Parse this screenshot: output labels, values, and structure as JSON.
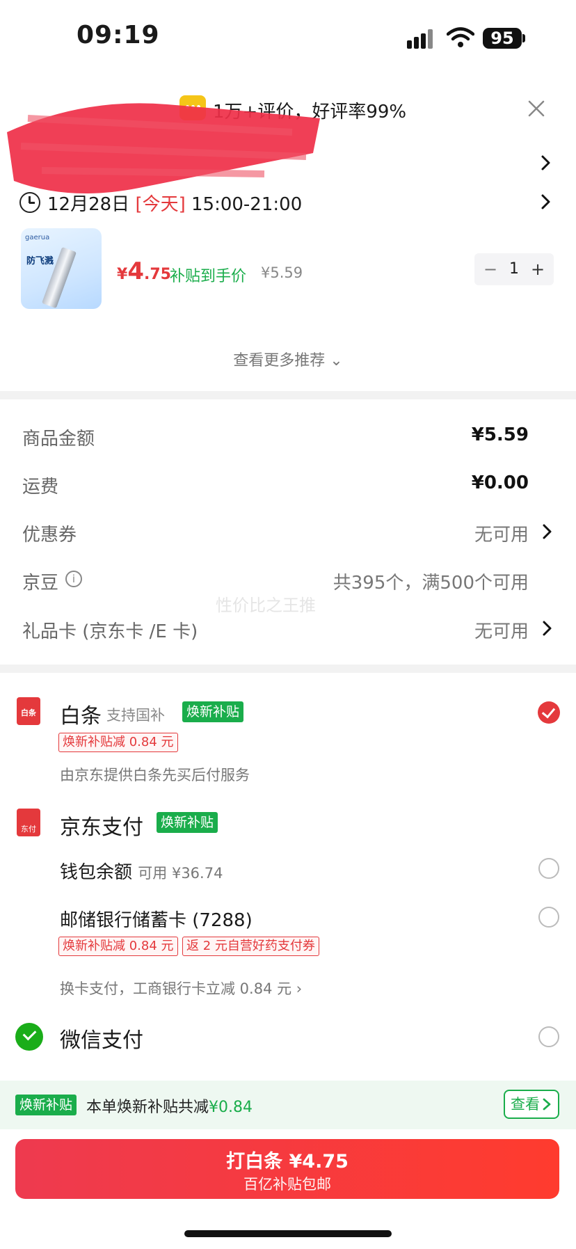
{
  "status_bar": {
    "time": "09:19",
    "battery": "95"
  },
  "review": {
    "text": "1万+评价，好评率99%"
  },
  "delivery": {
    "date": "12月28日",
    "today": "[今天]",
    "window": "15:00-21:00"
  },
  "product": {
    "brand": "gaerua",
    "image_title": "防飞溅",
    "price_currency": "¥",
    "price_int": "4",
    "price_dec": ".75",
    "subsidy_label": "补贴到手价",
    "original_price": "¥5.59",
    "quantity": "1",
    "minus": "−",
    "plus": "+"
  },
  "more_recommend": "查看更多推荐 ⌄",
  "summary": {
    "goods_label": "商品金额",
    "goods_value": "¥5.59",
    "shipping_label": "运费",
    "shipping_value": "¥0.00",
    "coupon_label": "优惠券",
    "coupon_value": "无可用",
    "jingdou_label": "京豆",
    "jingdou_value": "共395个，满500个可用",
    "giftcard_label": "礼品卡 (京东卡 /E 卡)",
    "giftcard_value": "无可用",
    "watermark": "性价比之王推"
  },
  "payment": {
    "baitiao": {
      "icon": "白条",
      "title": "白条",
      "sub": "支持国补",
      "tag": "焕新补贴",
      "discount": "焕新补贴减 0.84 元",
      "note": "由京东提供白条先买后付服务"
    },
    "jdpay": {
      "icon": "东付",
      "title": "京东支付",
      "tag": "焕新补贴",
      "wallet_label": "钱包余额",
      "wallet_hint": "可用 ¥36.74",
      "card_label": "邮储银行储蓄卡 (7288)",
      "card_discount": "焕新补贴减 0.84 元",
      "card_coupon": "返 2 元自营好药支付券",
      "switch_note": "换卡支付，工商银行卡立减 0.84 元 ›"
    },
    "wechat": {
      "title": "微信支付"
    }
  },
  "subsidy_bar": {
    "tag": "焕新补贴",
    "text": "本单焕新补贴共减",
    "amount": "¥0.84",
    "view": "查看"
  },
  "pay_button": {
    "line1": "打白条 ¥4.75",
    "line2": "百亿补贴包邮"
  },
  "colors": {
    "accent_red": "#e4393c",
    "green": "#1aad4b"
  }
}
